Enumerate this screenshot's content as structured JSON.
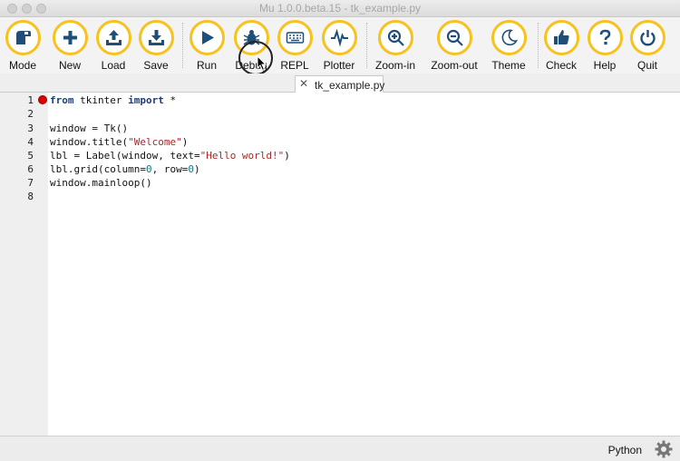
{
  "window": {
    "title": "Mu 1.0.0.beta.15 - tk_example.py"
  },
  "toolbar": {
    "buttons": [
      {
        "label": "Mode",
        "icon": "mode-icon"
      },
      {
        "label": "New",
        "icon": "plus-icon"
      },
      {
        "label": "Load",
        "icon": "upload-icon"
      },
      {
        "label": "Save",
        "icon": "download-icon"
      },
      {
        "label": "Run",
        "icon": "play-icon"
      },
      {
        "label": "Debug",
        "icon": "bug-icon"
      },
      {
        "label": "REPL",
        "icon": "keyboard-icon"
      },
      {
        "label": "Plotter",
        "icon": "pulse-icon"
      },
      {
        "label": "Zoom-in",
        "icon": "zoom-in-icon"
      },
      {
        "label": "Zoom-out",
        "icon": "zoom-out-icon"
      },
      {
        "label": "Theme",
        "icon": "moon-icon"
      },
      {
        "label": "Check",
        "icon": "thumbs-up-icon"
      },
      {
        "label": "Help",
        "icon": "question-icon"
      },
      {
        "label": "Quit",
        "icon": "power-icon"
      }
    ]
  },
  "tabs": [
    {
      "label": "tk_example.py",
      "close": "✕"
    }
  ],
  "editor": {
    "line_numbers": [
      "1",
      "2",
      "3",
      "4",
      "5",
      "6",
      "7",
      "8"
    ],
    "breakpoint_line": 1,
    "lines": [
      "from tkinter import *",
      "",
      "window = Tk()",
      "window.title(\"Welcome\")",
      "lbl = Label(window, text=\"Hello world!\")",
      "lbl.grid(column=0, row=0)",
      "window.mainloop()",
      ""
    ]
  },
  "statusbar": {
    "mode": "Python",
    "settings_icon": "gear-icon"
  },
  "colors": {
    "accent": "#f7c21b",
    "icon": "#1f4e79",
    "breakpoint": "#dd0000"
  }
}
